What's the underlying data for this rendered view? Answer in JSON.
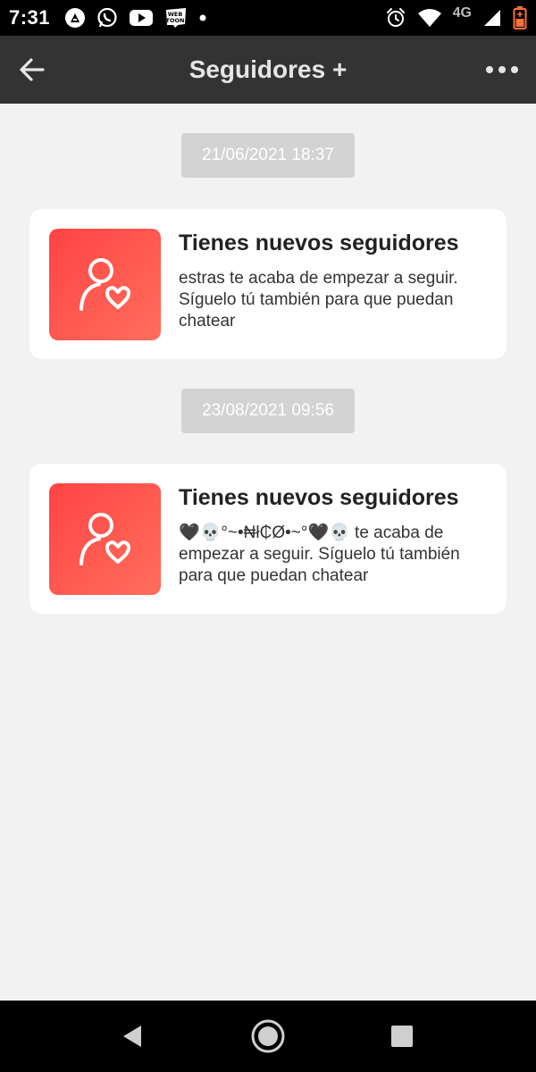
{
  "status_bar": {
    "time": "7:31",
    "left_icons": [
      "app-icon",
      "whatsapp-icon",
      "youtube-icon",
      "webtoon-icon",
      "dot-icon"
    ],
    "webtoon_text": "WEB TOON",
    "network_label": "4G",
    "battery_color": "#ff6f3c"
  },
  "app_bar": {
    "title": "Seguidores +",
    "background": "#333333"
  },
  "notifications": [
    {
      "date": "21/06/2021 18:37",
      "title": "Tienes nuevos seguidores",
      "message": "estras te acaba de empezar a seguir. Síguelo tú también para que puedan chatear"
    },
    {
      "date": "23/08/2021 09:56",
      "title": "Tienes nuevos seguidores",
      "message": "🖤💀°~•₦ł₵Ø•~°🖤💀 te acaba de empezar a seguir. Síguelo tú también para que puedan chatear"
    }
  ],
  "colors": {
    "accent_start": "#ff4444",
    "accent_end": "#ff6e5c",
    "page_background": "#f2f2f2",
    "date_pill": "#d3d3d3"
  }
}
